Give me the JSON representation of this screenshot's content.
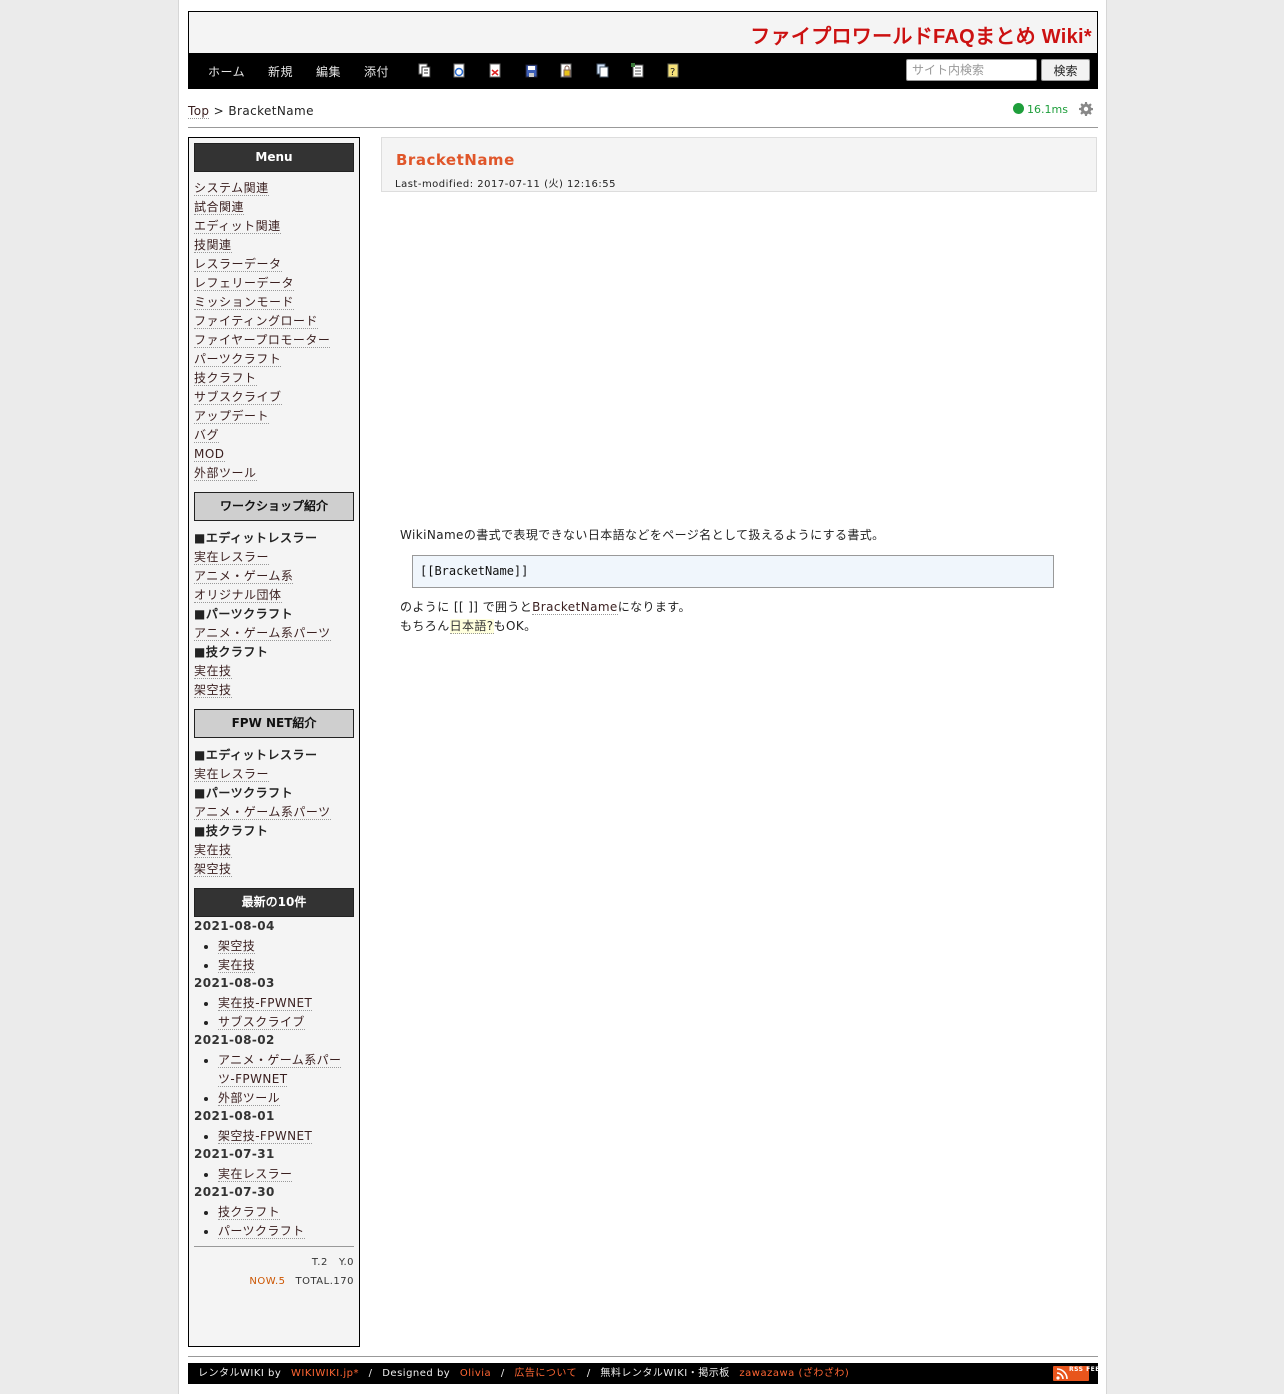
{
  "header": {
    "site_title": "ファイプロワールドFAQまとめ Wiki*",
    "nav": [
      "ホーム",
      "新規",
      "編集",
      "添付"
    ],
    "toolbar_icons": [
      "copy-page-icon",
      "reload-icon",
      "diff-icon",
      "backup-icon",
      "freeze-icon",
      "rename-icon",
      "list-icon",
      "help-icon"
    ],
    "search_placeholder": "サイト内検索",
    "search_button": "検索"
  },
  "breadcrumb": {
    "top": "Top",
    "separator": ">",
    "current": "BracketName"
  },
  "speed": "16.1ms",
  "menubar": {
    "menu_heading": "Menu",
    "menu_items": [
      "システム関連",
      "試合関連",
      "エディット関連",
      "技関連",
      "レスラーデータ",
      "レフェリーデータ",
      "ミッションモード",
      "ファイティングロード",
      "ファイヤープロモーター",
      "パーツクラフト",
      "技クラフト",
      "サブスクライブ",
      "アップデート",
      "バグ",
      "MOD",
      "外部ツール"
    ],
    "workshop_heading": "ワークショップ紹介",
    "workshop_items": [
      {
        "text": "■エディットレスラー",
        "cat": true
      },
      {
        "text": "実在レスラー",
        "cat": false
      },
      {
        "text": "アニメ・ゲーム系",
        "cat": false
      },
      {
        "text": "オリジナル団体",
        "cat": false
      },
      {
        "text": "■パーツクラフト",
        "cat": true
      },
      {
        "text": "アニメ・ゲーム系パーツ",
        "cat": false
      },
      {
        "text": "■技クラフト",
        "cat": true
      },
      {
        "text": "実在技",
        "cat": false
      },
      {
        "text": "架空技",
        "cat": false
      }
    ],
    "fpwnet_heading": "FPW NET紹介",
    "fpwnet_items": [
      {
        "text": "■エディットレスラー",
        "cat": true
      },
      {
        "text": "実在レスラー",
        "cat": false
      },
      {
        "text": "■パーツクラフト",
        "cat": true
      },
      {
        "text": "アニメ・ゲーム系パーツ",
        "cat": false
      },
      {
        "text": "■技クラフト",
        "cat": true
      },
      {
        "text": "実在技",
        "cat": false
      },
      {
        "text": "架空技",
        "cat": false
      }
    ],
    "recent_heading": "最新の10件",
    "recent": [
      {
        "date": "2021-08-04",
        "pages": [
          "架空技",
          "実在技"
        ]
      },
      {
        "date": "2021-08-03",
        "pages": [
          "実在技-FPWNET",
          "サブスクライブ"
        ]
      },
      {
        "date": "2021-08-02",
        "pages": [
          "アニメ・ゲーム系パーツ-FPWNET",
          "外部ツール"
        ]
      },
      {
        "date": "2021-08-01",
        "pages": [
          "架空技-FPWNET"
        ]
      },
      {
        "date": "2021-07-31",
        "pages": [
          "実在レスラー"
        ]
      },
      {
        "date": "2021-07-30",
        "pages": [
          "技クラフト",
          "パーツクラフト"
        ]
      }
    ],
    "counter_today": "T.2",
    "counter_yesterday": "Y.0",
    "counter_now": "NOW.5",
    "counter_total": "TOTAL.170"
  },
  "page": {
    "title": "BracketName",
    "last_modified": "Last-modified: 2017-07-11 (火) 12:16:55",
    "para1": "WikiNameの書式で表現できない日本語などをページ名として扱えるようにする書式。",
    "code": "[[BracketName]]",
    "para2_pre": "のように [[ ]] で囲うと",
    "para2_link": "BracketName",
    "para2_post": "になります。",
    "para3_pre": "もちろん",
    "para3_link": "日本語?",
    "para3_post": "もOK。"
  },
  "footer": {
    "rental": "レンタルWIKI by",
    "wikiwiki": "WIKIWIKI.jp*",
    "designed": "Designed by",
    "designer": "Olivia",
    "ad": "広告について",
    "free": "無料レンタルWIKI・掲示板",
    "zawazawa": "zawazawa (ざわざわ)",
    "rss_text": "RSS FEED"
  }
}
